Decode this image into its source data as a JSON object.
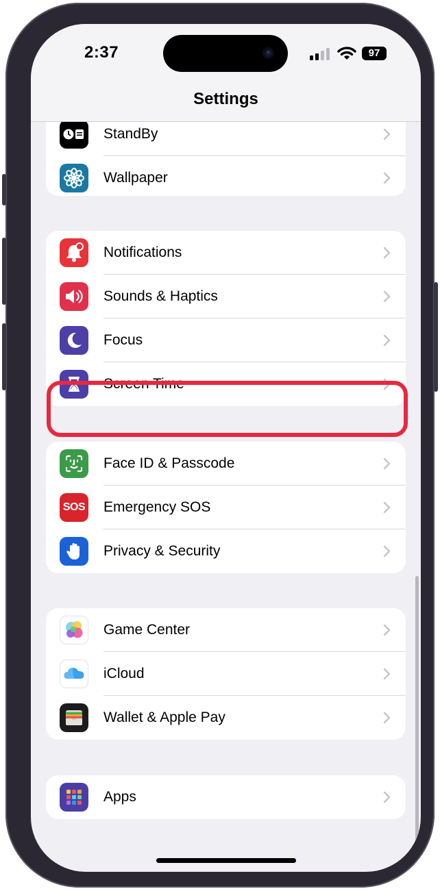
{
  "status": {
    "time": "2:37",
    "battery": "97"
  },
  "nav": {
    "title": "Settings"
  },
  "groups": [
    {
      "rows": [
        {
          "label": "StandBy",
          "icon": "standby-icon",
          "color": "#000000"
        },
        {
          "label": "Wallpaper",
          "icon": "wallpaper-icon",
          "color": "#1c79a3"
        }
      ]
    },
    {
      "rows": [
        {
          "label": "Notifications",
          "icon": "notifications-icon",
          "color": "#e8333a"
        },
        {
          "label": "Sounds & Haptics",
          "icon": "sounds-icon",
          "color": "#e0304b"
        },
        {
          "label": "Focus",
          "icon": "focus-icon",
          "color": "#4d3fa8"
        },
        {
          "label": "Screen Time",
          "icon": "screen-time-icon",
          "color": "#4d3fa8",
          "highlighted": true
        }
      ]
    },
    {
      "rows": [
        {
          "label": "Face ID & Passcode",
          "icon": "face-id-icon",
          "color": "#3a9b48"
        },
        {
          "label": "Emergency SOS",
          "icon": "emergency-sos-icon",
          "color": "#d9242c",
          "icon_text": "SOS"
        },
        {
          "label": "Privacy & Security",
          "icon": "privacy-hand-icon",
          "color": "#1b62d8"
        }
      ]
    },
    {
      "rows": [
        {
          "label": "Game Center",
          "icon": "game-center-icon",
          "color": "#ffffff"
        },
        {
          "label": "iCloud",
          "icon": "icloud-icon",
          "color": "#ffffff"
        },
        {
          "label": "Wallet & Apple Pay",
          "icon": "wallet-icon",
          "color": "#1c1c1e"
        }
      ]
    },
    {
      "rows": [
        {
          "label": "Apps",
          "icon": "apps-grid-icon",
          "color": "#4a3ea6"
        }
      ]
    }
  ],
  "highlight_color": "#e8283f"
}
